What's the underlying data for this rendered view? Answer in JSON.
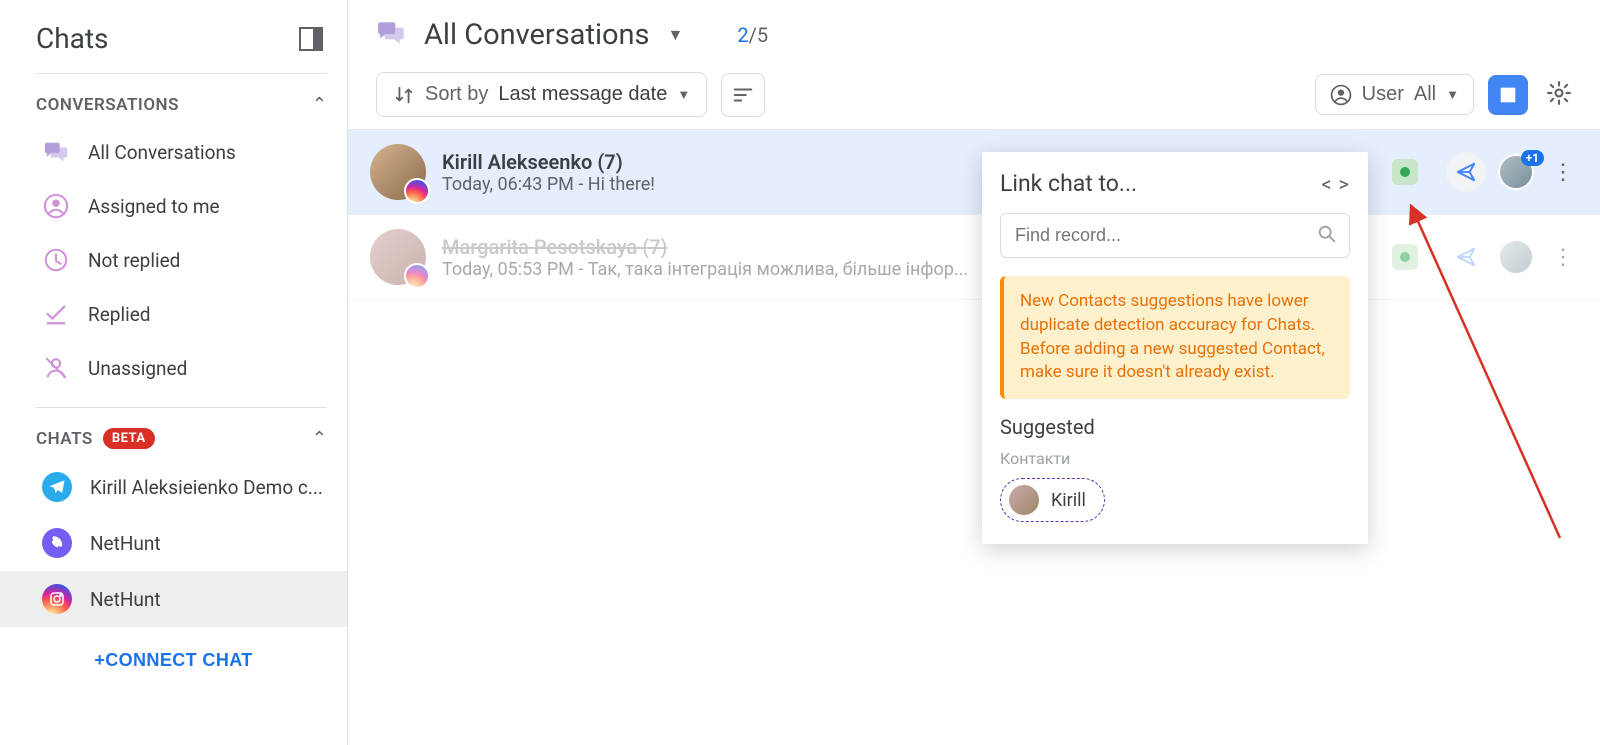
{
  "sidebar": {
    "title": "Chats",
    "sections": {
      "conversations": {
        "label": "CONVERSATIONS",
        "items": [
          {
            "icon": "chat-bubbles-icon",
            "label": "All Conversations"
          },
          {
            "icon": "user-circle-icon",
            "label": "Assigned to me"
          },
          {
            "icon": "clock-icon",
            "label": "Not replied"
          },
          {
            "icon": "check-underline-icon",
            "label": "Replied"
          },
          {
            "icon": "user-slash-icon",
            "label": "Unassigned"
          }
        ]
      },
      "chats": {
        "label": "CHATS",
        "beta_badge": "BETA",
        "items": [
          {
            "platform": "telegram",
            "label": "Kirill Aleksieienko Demo c..."
          },
          {
            "platform": "viber",
            "label": "NetHunt"
          },
          {
            "platform": "instagram",
            "label": "NetHunt",
            "active": true
          }
        ],
        "connect_label": "+CONNECT CHAT"
      }
    }
  },
  "header": {
    "title": "All Conversations",
    "count_current": "2",
    "count_total": "/5",
    "sort_label": "Sort by",
    "sort_value": "Last message date",
    "user_filter_label": "User",
    "user_filter_value": "All"
  },
  "conversations": [
    {
      "name": "Kirill Alekseenko (7)",
      "time_prefix": "Today, 06:43 PM - ",
      "snippet": "Hi there!",
      "platform": "instagram",
      "selected": true,
      "plus_badge": "+1"
    },
    {
      "name": "Margarita Pesotskaya (7)",
      "time_prefix": "Today, 05:53 PM - ",
      "snippet": "Так, така інтеграція можлива, більше інфор...",
      "platform": "instagram",
      "strike": true,
      "muted": true
    }
  ],
  "popover": {
    "title": "Link chat to...",
    "search_placeholder": "Find record...",
    "notice": "New Contacts suggestions have lower duplicate detection accuracy for Chats. Before adding a new suggested Contact, make sure it doesn't already exist.",
    "suggested_title": "Suggested",
    "group_label": "Контакти",
    "suggestion_name": "Kirill"
  }
}
